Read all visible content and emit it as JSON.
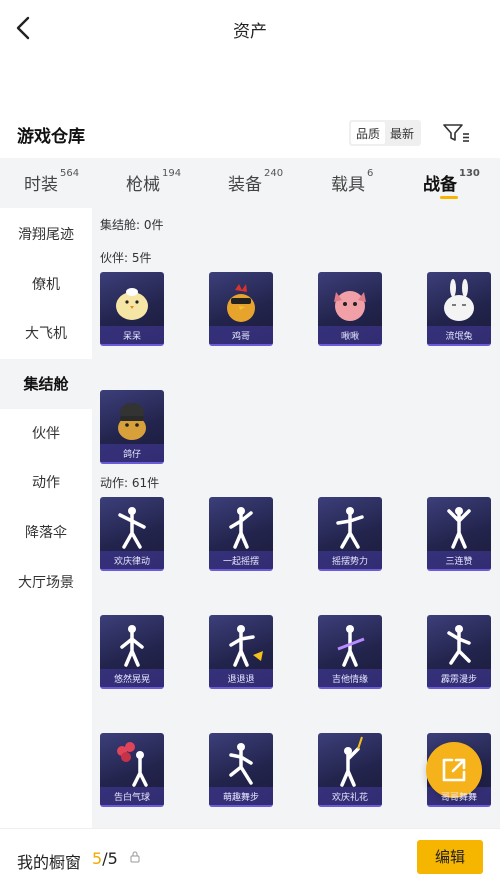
{
  "header": {
    "title": "资产"
  },
  "section": {
    "title": "游戏仓库",
    "sort_options": [
      "品质",
      "最新"
    ],
    "active_sort": 0
  },
  "tabs": [
    {
      "label": "时装",
      "count": "564"
    },
    {
      "label": "枪械",
      "count": "194"
    },
    {
      "label": "装备",
      "count": "240"
    },
    {
      "label": "载具",
      "count": "6"
    },
    {
      "label": "战备",
      "count": "130"
    }
  ],
  "sidebar": {
    "items": [
      {
        "label": "滑翔尾迹"
      },
      {
        "label": "僚机"
      },
      {
        "label": "大飞机"
      },
      {
        "label": "集结舱"
      },
      {
        "label": "伙伴"
      },
      {
        "label": "动作"
      },
      {
        "label": "降落伞"
      },
      {
        "label": "大厅场景"
      }
    ]
  },
  "content": {
    "pod_label": "集结舱: 0件",
    "partners_label": "伙伴: 5件",
    "partners": [
      {
        "name": "呆呆"
      },
      {
        "name": "鸡哥"
      },
      {
        "name": "啾啾"
      },
      {
        "name": "流氓兔"
      },
      {
        "name": "鸽仔"
      }
    ],
    "actions_label": "动作: 61件",
    "actions": [
      {
        "name": "欢庆律动"
      },
      {
        "name": "一起摇摆"
      },
      {
        "name": "摇摆势力"
      },
      {
        "name": "三连赞"
      },
      {
        "name": "悠然晃晃"
      },
      {
        "name": "退退退"
      },
      {
        "name": "吉他情缘"
      },
      {
        "name": "霹雳漫步"
      },
      {
        "name": "告白气球"
      },
      {
        "name": "萌趣舞步"
      },
      {
        "name": "欢庆礼花"
      },
      {
        "name": "哥哥舞舞"
      }
    ]
  },
  "bottom": {
    "showcase_label": "我的橱窗",
    "current": "5",
    "total": "/5",
    "edit_label": "编辑"
  },
  "colors": {
    "accent": "#f6b600",
    "card_bg": "#23244d",
    "card_label_bar": "#5a4bc0"
  }
}
